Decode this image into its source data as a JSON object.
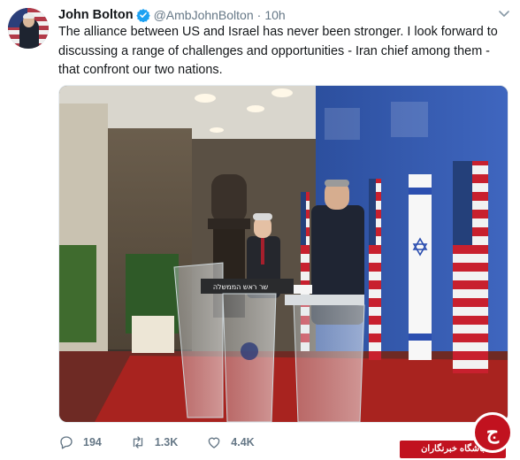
{
  "tweet": {
    "author_name": "John Bolton",
    "handle": "@AmbJohnBolton",
    "separator": "·",
    "time": "10h",
    "text": "The alliance between US and Israel has never been stronger. I look forward to discussing a range of challenges and opportunities - Iran chief among them - that confront our two nations.",
    "media_sign_text": "שר ראש הממשלה"
  },
  "actions": {
    "reply_count": "194",
    "retweet_count": "1.3K",
    "like_count": "4.4K"
  },
  "watermark": {
    "label": "باشگاه خبرنگاران",
    "glyph": "ج"
  },
  "icons": [
    "verified-badge-icon",
    "caret-down-icon",
    "reply-icon",
    "retweet-icon",
    "like-icon"
  ],
  "colors": {
    "accent": "#1da1f2",
    "text_primary": "#14171a",
    "text_secondary": "#657786",
    "watermark_red": "#c1121f"
  }
}
